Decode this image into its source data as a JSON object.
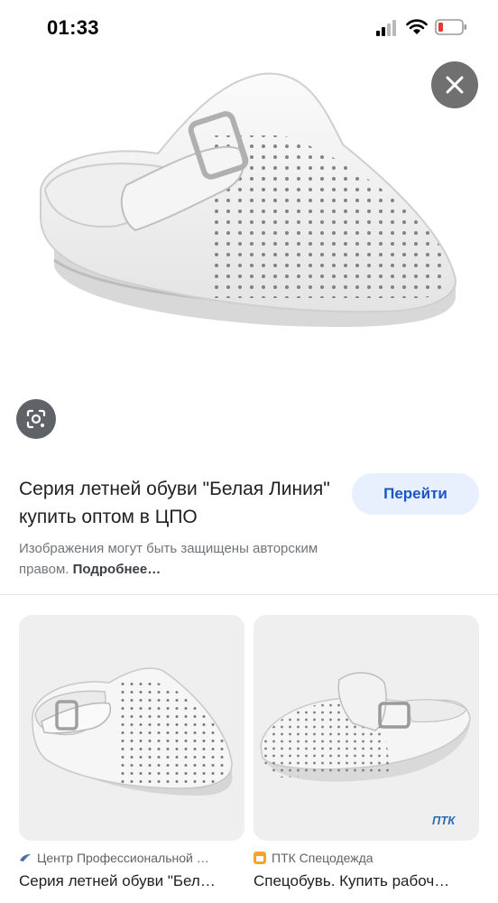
{
  "status_bar": {
    "time": "01:33"
  },
  "icons": {
    "close": "close-icon",
    "lens": "lens-icon",
    "signal": "signal-icon",
    "wifi": "wifi-icon",
    "battery": "battery-icon"
  },
  "result": {
    "title": "Серия летней обуви \"Белая Линия\" купить оптом в ЦПО",
    "visit_label": "Перейти",
    "copyright_text": "Изображения могут быть защищены авторским правом.",
    "more_label": "Подробнее…"
  },
  "related": [
    {
      "source": "Центр Профессиональной …",
      "title": "Серия летней обуви \"Бел…"
    },
    {
      "source": "ПТК Спецодежда",
      "title": "Спецобувь. Купить рабоч…",
      "watermark": "ПТК"
    }
  ],
  "colors": {
    "visit_button_bg": "#e8f0fe",
    "visit_button_text": "#1a56c4",
    "close_button_bg": "#707070",
    "lens_button_bg": "#5f6368",
    "card_bg": "#efefef"
  }
}
